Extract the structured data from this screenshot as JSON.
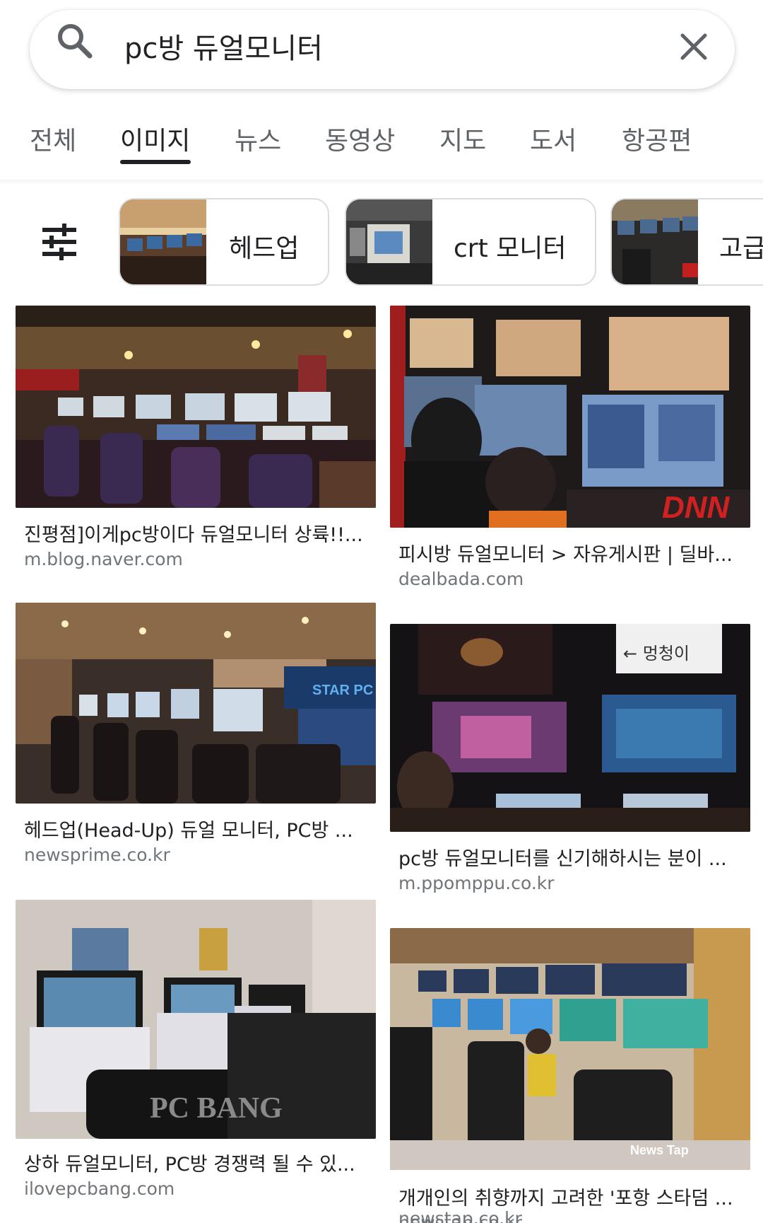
{
  "search": {
    "query": "pc방 듀얼모니터"
  },
  "tabs": [
    {
      "label": "전체"
    },
    {
      "label": "이미지"
    },
    {
      "label": "뉴스"
    },
    {
      "label": "동영상"
    },
    {
      "label": "지도"
    },
    {
      "label": "도서"
    },
    {
      "label": "항공편"
    }
  ],
  "active_tab": "이미지",
  "chips": [
    {
      "label": "헤드업"
    },
    {
      "label": "crt 모니터"
    },
    {
      "label": "고급"
    }
  ],
  "results": [
    {
      "title": "진평점]이게pc방이다 듀얼모니터 상륙!!...",
      "source": "m.blog.naver.com"
    },
    {
      "title": "피시방 듀얼모니터 > 자유게시판 | 딜바...",
      "source": "dealbada.com"
    },
    {
      "title": "헤드업(Head-Up) 듀얼 모니터, PC방 ...",
      "source": "newsprime.co.kr"
    },
    {
      "title": "pc방 듀얼모니터를 신기해하시는 분이 ...",
      "source": "m.ppomppu.co.kr"
    },
    {
      "title": "상하 듀얼모니터, PC방 경쟁력 될 수 있...",
      "source": "ilovepcbang.com"
    },
    {
      "title": "개개인의 취향까지 고려한 '포항 스타덤 ...",
      "source": "newstap.co.kr"
    }
  ],
  "image_overlays": {
    "dnn_logo": "DNN",
    "handwritten_note": "← 멍청이",
    "pcbang_watermark": "PC BANG",
    "newstap_watermark": "News Tap",
    "star_pc_sign": "STAR PC"
  },
  "colors": {
    "text_primary": "#202124",
    "text_secondary": "#5f6368",
    "source_gray": "#70757a",
    "chip_border": "#dadce0"
  }
}
